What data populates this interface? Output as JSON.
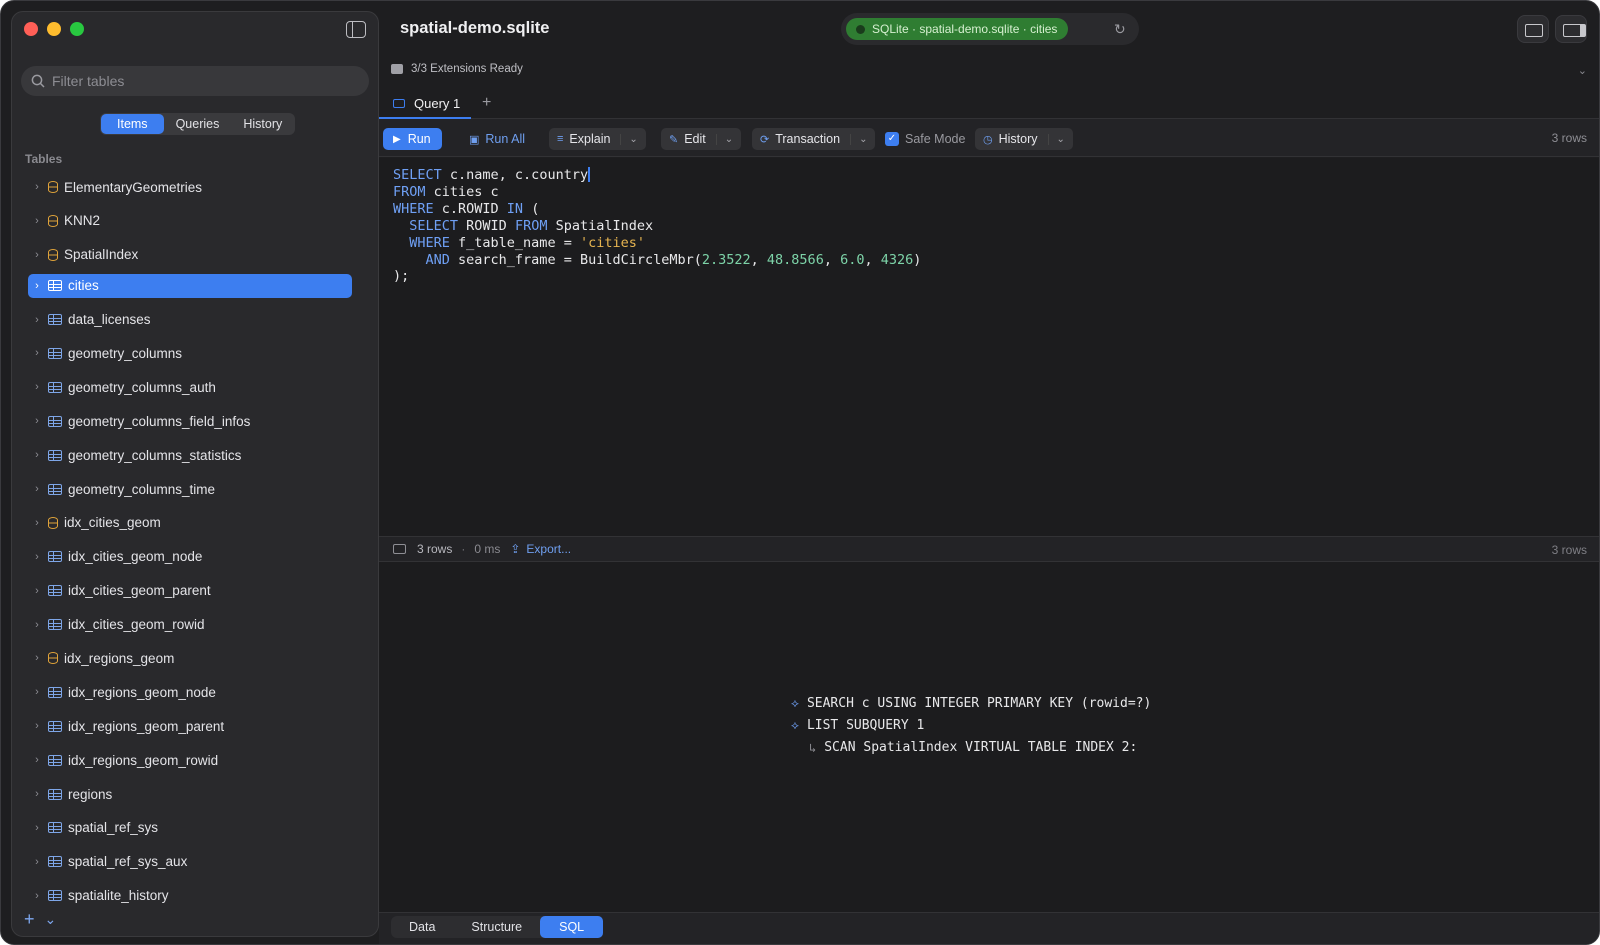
{
  "sidebar": {
    "filter_placeholder": "Filter tables",
    "segments": [
      "Items",
      "Queries",
      "History"
    ],
    "section_label": "Tables",
    "items": [
      {
        "label": "ElementaryGeometries",
        "icon": "database-icon"
      },
      {
        "label": "KNN2",
        "icon": "database-icon"
      },
      {
        "label": "SpatialIndex",
        "icon": "database-icon"
      },
      {
        "label": "cities",
        "icon": "table-icon",
        "selected": true
      },
      {
        "label": "data_licenses",
        "icon": "table-icon"
      },
      {
        "label": "geometry_columns",
        "icon": "table-icon"
      },
      {
        "label": "geometry_columns_auth",
        "icon": "table-icon"
      },
      {
        "label": "geometry_columns_field_infos",
        "icon": "table-icon"
      },
      {
        "label": "geometry_columns_statistics",
        "icon": "table-icon"
      },
      {
        "label": "geometry_columns_time",
        "icon": "table-icon"
      },
      {
        "label": "idx_cities_geom",
        "icon": "database-icon"
      },
      {
        "label": "idx_cities_geom_node",
        "icon": "table-icon"
      },
      {
        "label": "idx_cities_geom_parent",
        "icon": "table-icon"
      },
      {
        "label": "idx_cities_geom_rowid",
        "icon": "table-icon"
      },
      {
        "label": "idx_regions_geom",
        "icon": "database-icon"
      },
      {
        "label": "idx_regions_geom_node",
        "icon": "table-icon"
      },
      {
        "label": "idx_regions_geom_parent",
        "icon": "table-icon"
      },
      {
        "label": "idx_regions_geom_rowid",
        "icon": "table-icon"
      },
      {
        "label": "regions",
        "icon": "table-icon"
      },
      {
        "label": "spatial_ref_sys",
        "icon": "table-icon"
      },
      {
        "label": "spatial_ref_sys_aux",
        "icon": "table-icon"
      },
      {
        "label": "spatialite_history",
        "icon": "table-icon"
      }
    ],
    "footer_add": "+",
    "footer_chevron": "⌄"
  },
  "header": {
    "title": "spatial-demo.sqlite",
    "connection": "SQLite · spatial-demo.sqlite · cities",
    "extensions": "3/3 Extensions Ready"
  },
  "tabs": {
    "query_tab": "Query 1",
    "add": "+"
  },
  "toolbar": {
    "run": "Run",
    "run_all": "Run All",
    "explain": "Explain",
    "edit": "Edit",
    "transaction": "Transaction",
    "safe_mode": "Safe Mode",
    "history": "History",
    "row_count": "3 rows"
  },
  "editor": {
    "lines": [
      [
        [
          "kw",
          "SELECT"
        ],
        [
          "t",
          " c.name, c.country"
        ]
      ],
      [
        [
          "kw",
          "FROM"
        ],
        [
          "t",
          " cities c"
        ]
      ],
      [
        [
          "kw",
          "WHERE"
        ],
        [
          "t",
          " c.ROWID "
        ],
        [
          "kw",
          "IN"
        ],
        [
          "t",
          " ("
        ]
      ],
      [
        [
          "t",
          "  "
        ],
        [
          "kw",
          "SELECT"
        ],
        [
          "t",
          " ROWID "
        ],
        [
          "kw",
          "FROM"
        ],
        [
          "t",
          " SpatialIndex"
        ]
      ],
      [
        [
          "t",
          "  "
        ],
        [
          "kw",
          "WHERE"
        ],
        [
          "t",
          " f_table_name = "
        ],
        [
          "str",
          "'cities'"
        ]
      ],
      [
        [
          "t",
          "    "
        ],
        [
          "kw",
          "AND"
        ],
        [
          "t",
          " search_frame = BuildCircleMbr("
        ],
        [
          "num",
          "2.3522"
        ],
        [
          "t",
          ", "
        ],
        [
          "num",
          "48.8566"
        ],
        [
          "t",
          ", "
        ],
        [
          "num",
          "6.0"
        ],
        [
          "t",
          ", "
        ],
        [
          "num",
          "4326"
        ],
        [
          "t",
          ")"
        ]
      ],
      [
        [
          "t",
          ");"
        ]
      ]
    ]
  },
  "results": {
    "rows": "3 rows",
    "separator": "·",
    "time": "0 ms",
    "export": "Export...",
    "rows_right": "3 rows"
  },
  "plan": {
    "lines": [
      {
        "text": "SEARCH c USING INTEGER PRIMARY KEY (rowid=?)",
        "level": 0
      },
      {
        "text": "LIST SUBQUERY 1",
        "level": 0
      },
      {
        "text": "SCAN SpatialIndex VIRTUAL TABLE INDEX 2:",
        "level": 1
      }
    ]
  },
  "bottom_tabs": [
    "Data",
    "Structure",
    "SQL"
  ],
  "colors": {
    "accent": "#3d7ef0",
    "status_green": "#2f7d32",
    "keyword": "#6fa0f5",
    "string": "#e6b450",
    "number": "#7dd3a8",
    "db_icon": "#e0a33a"
  }
}
